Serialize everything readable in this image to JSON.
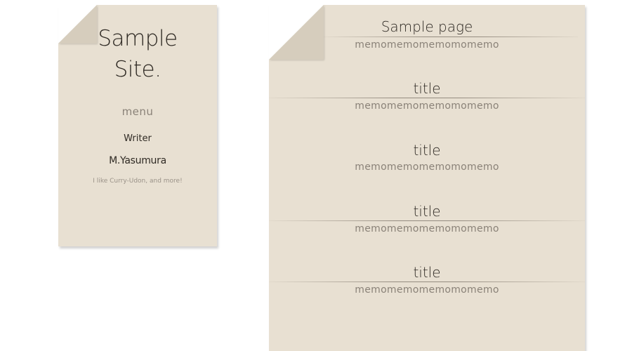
{
  "sidebar": {
    "title_line1": "Sample",
    "title_line2": "Site.",
    "menu_label": "menu",
    "writer_label": "Writer",
    "writer_name": "M.Yasumura",
    "writer_bio": "I like Curry-Udon, and more!"
  },
  "main": {
    "page_title": "Sample page",
    "page_memo": "memomemomemomomemo",
    "entries": [
      {
        "title": "title",
        "memo": "memomemomemomomemo"
      },
      {
        "title": "title",
        "memo": "memomemomemomomemo"
      },
      {
        "title": "title",
        "memo": "memomemomemomomemo"
      },
      {
        "title": "title",
        "memo": "memomemomemomomemo"
      }
    ]
  },
  "colors": {
    "paper": "#e8e0d2",
    "fold": "#d6cdbd",
    "text_dark": "#2f2a24",
    "text_muted": "#8a8278"
  }
}
